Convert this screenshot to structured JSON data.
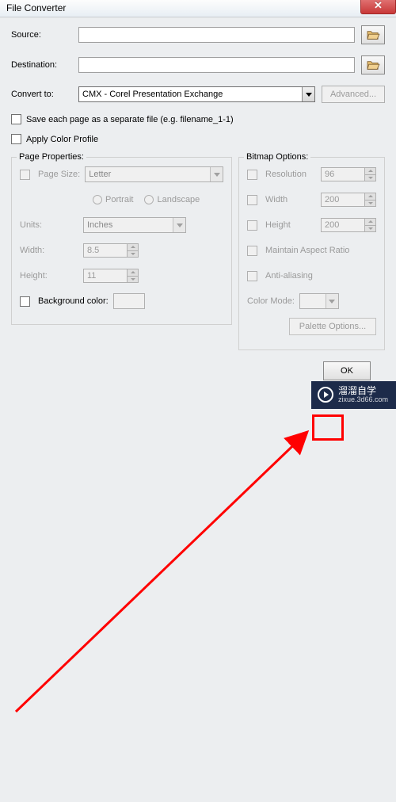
{
  "window": {
    "title": "File Converter"
  },
  "labels": {
    "source": "Source:",
    "destination": "Destination:",
    "convert_to": "Convert to:",
    "advanced": "Advanced...",
    "save_each": "Save each page as a separate file (e.g. filename_1-1)",
    "apply_profile": "Apply Color Profile",
    "page_props": "Page Properties:",
    "bitmap_opts": "Bitmap Options:",
    "page_size": "Page Size:",
    "portrait": "Portrait",
    "landscape": "Landscape",
    "units": "Units:",
    "width": "Width:",
    "height": "Height:",
    "bgcolor": "Background color:",
    "resolution": "Resolution",
    "b_width": "Width",
    "b_height": "Height",
    "maintain": "Maintain Aspect Ratio",
    "antialias": "Anti-aliasing",
    "color_mode": "Color Mode:",
    "palette": "Palette Options...",
    "ok": "OK"
  },
  "values": {
    "source": "",
    "destination": "",
    "convert_format": "CMX - Corel Presentation Exchange",
    "page_size": "Letter",
    "units": "Inches",
    "width": "8.5",
    "height": "11",
    "resolution": "96",
    "b_width": "200",
    "b_height": "200",
    "color_mode": ""
  },
  "watermark": {
    "brand": "溜溜自学",
    "url": "zixue.3d66.com"
  }
}
